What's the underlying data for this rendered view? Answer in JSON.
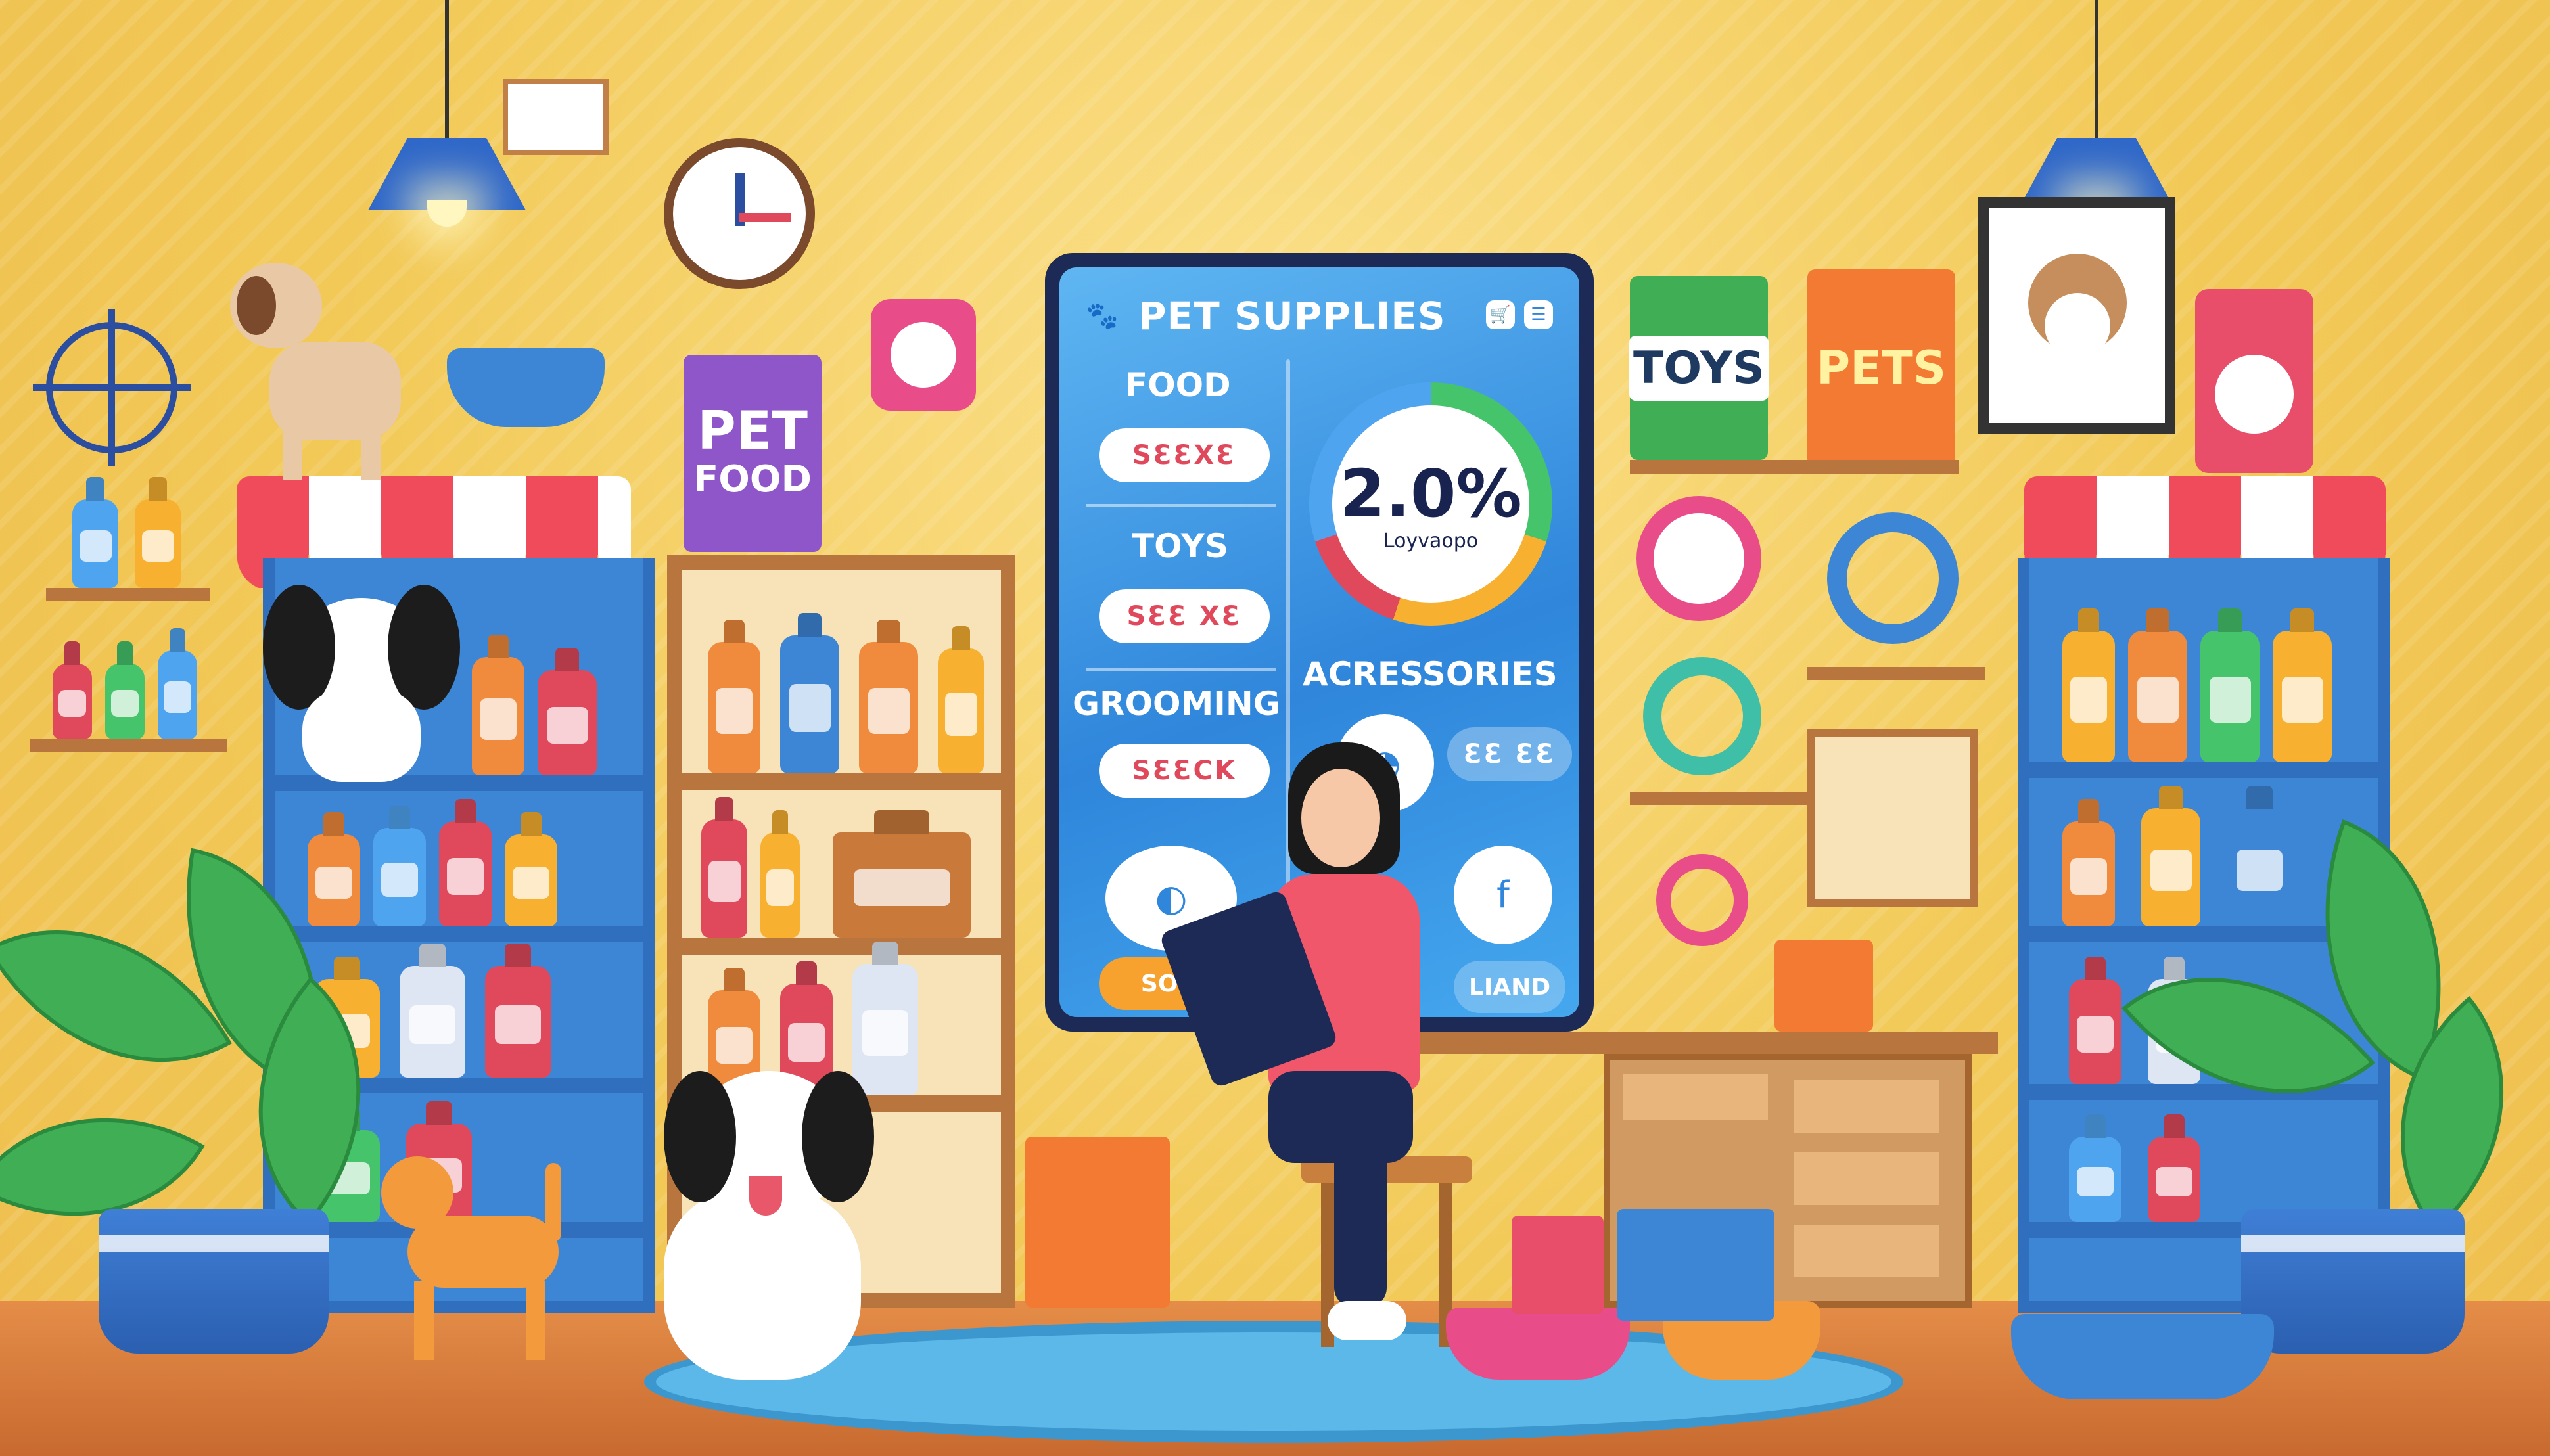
{
  "screen": {
    "title": "PET SUPPLIES",
    "categories": [
      {
        "label": "FOOD",
        "pill": "SƐƐXƐ"
      },
      {
        "label": "TOYS",
        "pill": "SƐƐ XƐ"
      },
      {
        "label": "GROOMING",
        "pill": "SƐƐCK"
      }
    ],
    "right_category": "ACRESSORIES",
    "badge_value": "2.0%",
    "badge_sub": "Loyvaopo",
    "cta_left": "SOOƐ",
    "cta_right": "LIAND",
    "accessory_pill": "ƐƐ ƐƐ",
    "round_button_right": "f"
  },
  "signs": {
    "pet_food": [
      "PET",
      "FOOD"
    ],
    "toys": "TOYS",
    "pets": "PETS"
  },
  "colors": {
    "wall": "#f2c957",
    "screen_blue": "#2f86db",
    "awning_red": "#ef4b5a",
    "shelf_blue": "#3d86d6",
    "accent_pink": "#e0495b"
  }
}
